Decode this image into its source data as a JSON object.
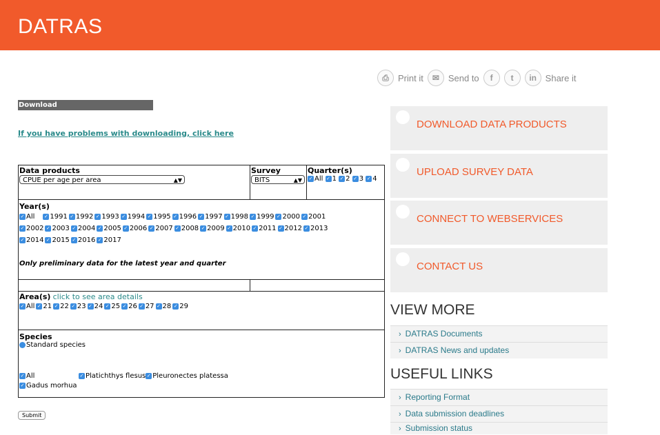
{
  "header": {
    "title": "DATRAS"
  },
  "share": {
    "print": "Print it",
    "send": "Send to",
    "share": "Share it"
  },
  "download": {
    "header": "Download",
    "problem_link": "If you have problems with downloading, click here"
  },
  "form": {
    "data_products_label": "Data products",
    "data_products_value": "CPUE per age per area",
    "survey_label": "Survey",
    "survey_value": "BITS",
    "quarter_label": "Quarter(s)",
    "quarters": [
      "All",
      "1",
      "2",
      "3",
      "4"
    ],
    "years_label": "Year(s)",
    "years_row1": [
      "All",
      "1991",
      "1992",
      "1993",
      "1994",
      "1995",
      "1996",
      "1997",
      "1998",
      "1999",
      "2000",
      "2001"
    ],
    "years_row2": [
      "2002",
      "2003",
      "2004",
      "2005",
      "2006",
      "2007",
      "2008",
      "2009",
      "2010",
      "2011",
      "2012",
      "2013"
    ],
    "years_row3": [
      "2014",
      "2015",
      "2016",
      "2017"
    ],
    "prelim_note": "Only preliminary data for the latest year and quarter",
    "areas_label": "Area(s)",
    "areas_link": "click to see area details",
    "areas": [
      "All",
      "21",
      "22",
      "23",
      "24",
      "25",
      "26",
      "27",
      "28",
      "29"
    ],
    "species_label": "Species",
    "species_radio": "Standard species",
    "species_all": "All",
    "species_1": "Platichthys flesus",
    "species_2": "Pleuronectes platessa",
    "species_3": "Gadus morhua",
    "submit": "Submit"
  },
  "sidebar": {
    "buttons": [
      "DOWNLOAD DATA PRODUCTS",
      "UPLOAD SURVEY DATA",
      "CONNECT TO WEBSERVICES",
      "CONTACT US"
    ],
    "view_more_title": "VIEW MORE",
    "view_more": [
      "DATRAS Documents",
      "DATRAS News and updates"
    ],
    "useful_title": "USEFUL LINKS",
    "useful": [
      "Reporting Format",
      "Data submission deadlines",
      "Submission status"
    ]
  }
}
